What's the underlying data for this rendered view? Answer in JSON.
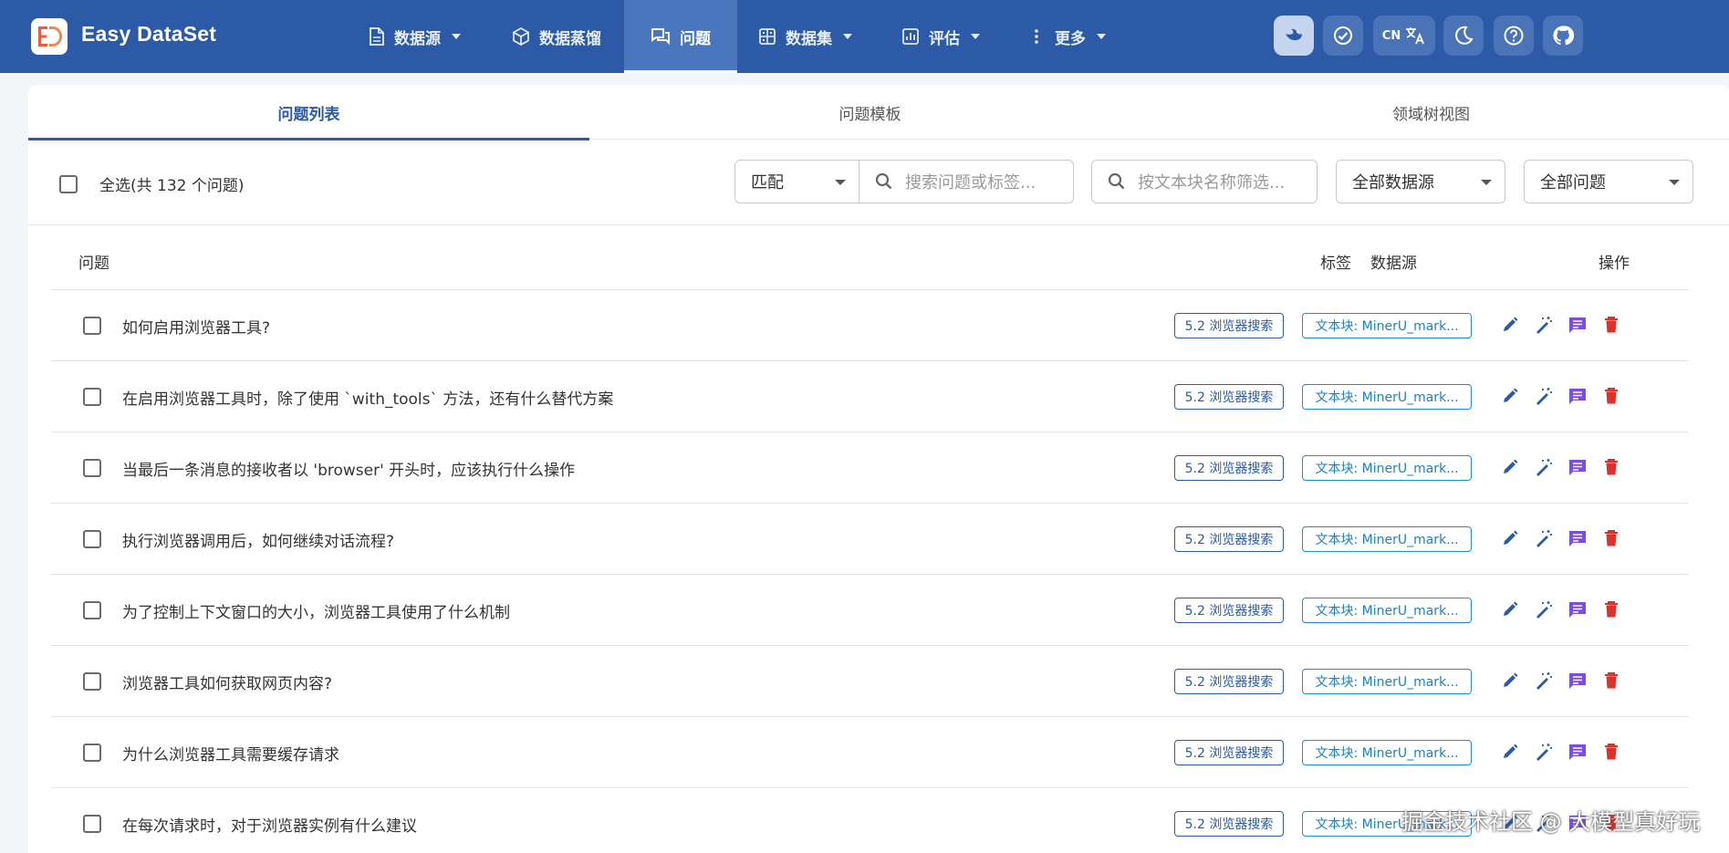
{
  "app": {
    "name": "Easy DataSet"
  },
  "nav": {
    "items": [
      {
        "label": "数据源",
        "icon": "document-icon",
        "caret": true
      },
      {
        "label": "数据蒸馏",
        "icon": "cube-icon",
        "caret": false
      },
      {
        "label": "问题",
        "icon": "chat-icon",
        "caret": false,
        "active": true
      },
      {
        "label": "数据集",
        "icon": "grid-icon",
        "caret": true
      },
      {
        "label": "评估",
        "icon": "chart-icon",
        "caret": true
      },
      {
        "label": "更多",
        "icon": "more-vertical-icon",
        "caret": true
      }
    ],
    "lang": "CN"
  },
  "tabs": [
    {
      "label": "问题列表",
      "active": true
    },
    {
      "label": "问题模板"
    },
    {
      "label": "领域树视图"
    }
  ],
  "filters": {
    "select_all_label": "全选(共 132 个问题)",
    "match_mode": "匹配",
    "search_placeholder": "搜索问题或标签...",
    "chunk_placeholder": "按文本块名称筛选...",
    "source_select": "全部数据源",
    "question_select": "全部问题"
  },
  "table": {
    "headers": {
      "question": "问题",
      "tag": "标签",
      "source": "数据源",
      "actions": "操作"
    },
    "rows": [
      {
        "question": "如何启用浏览器工具?",
        "tag": "5.2 浏览器搜索",
        "source": "文本块: MinerU_mark..."
      },
      {
        "question": "在启用浏览器工具时，除了使用 `with_tools` 方法，还有什么替代方案",
        "tag": "5.2 浏览器搜索",
        "source": "文本块: MinerU_mark..."
      },
      {
        "question": "当最后一条消息的接收者以 'browser' 开头时，应该执行什么操作",
        "tag": "5.2 浏览器搜索",
        "source": "文本块: MinerU_mark..."
      },
      {
        "question": "执行浏览器调用后，如何继续对话流程?",
        "tag": "5.2 浏览器搜索",
        "source": "文本块: MinerU_mark..."
      },
      {
        "question": "为了控制上下文窗口的大小，浏览器工具使用了什么机制",
        "tag": "5.2 浏览器搜索",
        "source": "文本块: MinerU_mark..."
      },
      {
        "question": "浏览器工具如何获取网页内容?",
        "tag": "5.2 浏览器搜索",
        "source": "文本块: MinerU_mark..."
      },
      {
        "question": "为什么浏览器工具需要缓存请求",
        "tag": "5.2 浏览器搜索",
        "source": "文本块: MinerU_mark..."
      },
      {
        "question": "在每次请求时，对于浏览器实例有什么建议",
        "tag": "5.2 浏览器搜索",
        "source": "文本块: MinerU_mark..."
      }
    ]
  },
  "watermark": "掘金技术社区 @ 大模型真好玩",
  "colors": {
    "nav_bg": "#2c5aa7",
    "accent": "#2c5aa7",
    "edit": "#2c5aa7",
    "ai": "#2c5aa7",
    "chat": "#7b4ee0",
    "delete": "#e0302a"
  }
}
